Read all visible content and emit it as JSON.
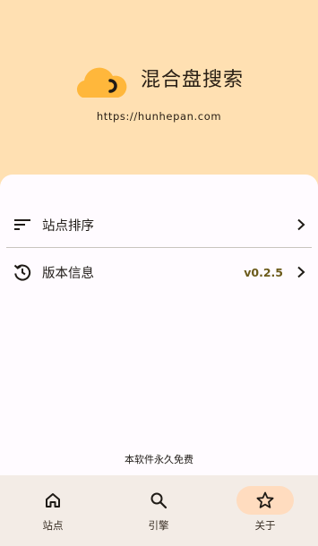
{
  "app": {
    "name": "混合盘搜索",
    "url": "https://hunhepan.com",
    "logo_icon": "cloud-icon",
    "colors": {
      "header_bg": "#ffe0b2",
      "logo": "#ffb73b",
      "accent_pill": "#ffdcbf",
      "version": "#6b5a1a"
    }
  },
  "settings": {
    "items": [
      {
        "label": "站点排序",
        "icon": "sort-icon"
      },
      {
        "label": "版本信息",
        "icon": "history-icon",
        "value": "v0.2.5"
      }
    ]
  },
  "footer_note": "本软件永久免费",
  "nav": {
    "items": [
      {
        "label": "站点",
        "icon": "home-icon",
        "active": false
      },
      {
        "label": "引擎",
        "icon": "search-icon",
        "active": false
      },
      {
        "label": "关于",
        "icon": "star-icon",
        "active": true
      }
    ]
  }
}
